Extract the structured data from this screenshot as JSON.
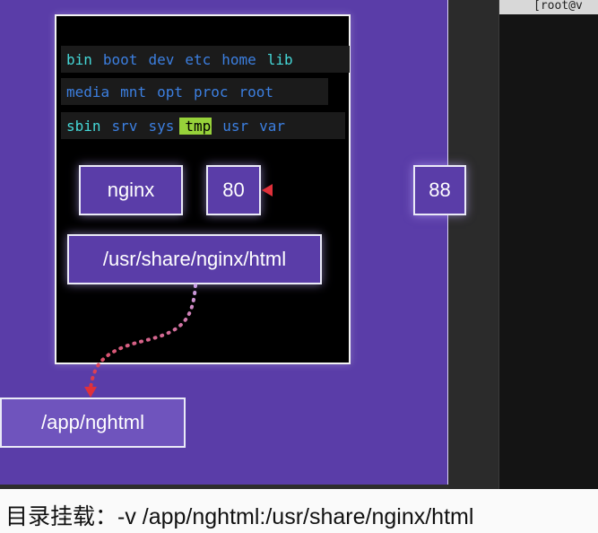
{
  "terminal": {
    "prompt": "[root@v"
  },
  "container": {
    "rows": [
      [
        {
          "text": "bin",
          "color": "cyan"
        },
        {
          "text": "boot",
          "color": "blue"
        },
        {
          "text": "dev",
          "color": "blue"
        },
        {
          "text": "etc",
          "color": "blue"
        },
        {
          "text": "home",
          "color": "blue"
        },
        {
          "text": "lib",
          "color": "cyan"
        }
      ],
      [
        {
          "text": "media",
          "color": "blue"
        },
        {
          "text": "mnt",
          "color": "blue"
        },
        {
          "text": "opt",
          "color": "blue"
        },
        {
          "text": "proc",
          "color": "blue"
        },
        {
          "text": "root",
          "color": "blue"
        }
      ],
      [
        {
          "text": "sbin",
          "color": "cyan"
        },
        {
          "text": "srv",
          "color": "blue"
        },
        {
          "text": "sys",
          "color": "blue"
        },
        {
          "text": "tmp",
          "color": "highlight"
        },
        {
          "text": "usr",
          "color": "blue"
        },
        {
          "text": "var",
          "color": "blue"
        }
      ]
    ],
    "app_label": "nginx",
    "port": "80",
    "path": "/usr/share/nginx/html"
  },
  "host": {
    "port": "88",
    "path": "/app/nghtml"
  },
  "caption": "目录挂载：-v /app/nghtml:/usr/share/nginx/html",
  "colors": {
    "panel": "#5a3da8",
    "cyan": "#45d8d8",
    "blue": "#3c7fe0",
    "highlight": "#97d23a",
    "arrow": "#e0303a"
  }
}
